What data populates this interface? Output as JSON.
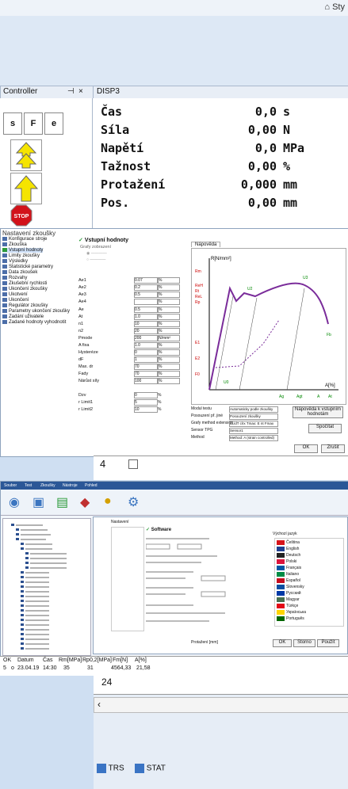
{
  "top": {
    "style_label": "Sty"
  },
  "controller": {
    "title": "Controller",
    "pin_glyph": "⊣",
    "close_glyph": "×",
    "btn_s": "s",
    "btn_f": "F",
    "btn_e": "e",
    "stop_label": "STOP"
  },
  "display": {
    "title": "DISP3",
    "rows": [
      {
        "label": "Čas",
        "value": "0,0",
        "unit": "s"
      },
      {
        "label": "Síla",
        "value": "0,00",
        "unit": "N"
      },
      {
        "label": "Napětí",
        "value": "0,0",
        "unit": "MPa"
      },
      {
        "label": "Tažnost",
        "value": "0,00",
        "unit": "%"
      },
      {
        "label": "Protažení",
        "value": "0,000",
        "unit": "mm"
      },
      {
        "label": "Pos.",
        "value": "0,00",
        "unit": "mm"
      }
    ]
  },
  "dialog1": {
    "title": "Nastavení zkoušky",
    "tree": [
      "Konfigurace stroje",
      "Zkouška",
      "Vstupní hodnoty",
      "Limity zkoušky",
      "Výsledky",
      "Statistické parametry",
      "Data zkoušek",
      "Rozvahy",
      "Zkušební rychlosti",
      "Ukončení zkoušky",
      "Ukotvení",
      "Ukončení",
      "Regulátor zkoušky",
      "Parametry ukončení zkoušky",
      "Zadání uživatele",
      "Zadané hodnoty vyhodnotit"
    ],
    "section_title": "Vstupní hodnoty",
    "subsection": "Grafy zobrazení",
    "graph_tab": "Nápověda",
    "fields": [
      {
        "label": "Ae1",
        "value": "0.07",
        "unit": "%"
      },
      {
        "label": "Ae2",
        "value": "0.2",
        "unit": "%"
      },
      {
        "label": "Ae3",
        "value": "0.5",
        "unit": "%"
      },
      {
        "label": "Ae4",
        "value": "",
        "unit": "%"
      },
      {
        "label": "Ae",
        "value": "0.5",
        "unit": "%"
      },
      {
        "label": "At",
        "value": "1.0",
        "unit": "%"
      },
      {
        "label": "n1",
        "value": "10",
        "unit": "%"
      },
      {
        "label": "n2",
        "value": "20",
        "unit": "%"
      },
      {
        "label": "Pmode",
        "value": "200",
        "unit": "N/mm²"
      },
      {
        "label": "A fixa",
        "value": "1.0",
        "unit": "%"
      },
      {
        "label": "Hysteréze",
        "value": "0",
        "unit": "%"
      },
      {
        "label": "dF",
        "value": "1",
        "unit": "%"
      },
      {
        "label": "Max. dr",
        "value": "70",
        "unit": "%"
      },
      {
        "label": "Fady",
        "value": "70",
        "unit": "%"
      },
      {
        "label": "Nárůst síly",
        "value": "100",
        "unit": "%"
      }
    ],
    "fields2": [
      {
        "label": "Dzv",
        "value": "0",
        "unit": "%"
      },
      {
        "label": "r Limit1",
        "value": "5",
        "unit": "%"
      },
      {
        "label": "r Limit2",
        "value": "10",
        "unit": "%"
      }
    ],
    "graph_labels": {
      "y": "R[N/mm²]",
      "x": "A[%]",
      "pts": [
        "Rm",
        "ReH",
        "Rt",
        "ReL",
        "Rp",
        "U3",
        "U2",
        "Fb",
        "E1",
        "E2",
        "F0",
        "U0",
        "Ag",
        "Agt",
        "A",
        "At"
      ]
    },
    "selects": [
      {
        "label": "Modul testu",
        "value": "Automaticky podle zkoušky"
      },
      {
        "label": "Posouzení př. jiné",
        "value": "Posouzení zkoušky"
      },
      {
        "label": "Grafy method extension",
        "value": "dL/dT clrx Tmax: E nt Fmax"
      },
      {
        "label": "Sensor TPG",
        "value": "Sensor1"
      },
      {
        "label": "Method",
        "value": "Method: A (strain controlled)"
      }
    ],
    "help_btn": "Nápověda k vstupním hodnotám",
    "calc_btn": "Spočítat",
    "ok_btn": "OK",
    "cancel_btn": "Zrušit"
  },
  "grid": {
    "row_number": "4"
  },
  "app2": {
    "menu": [
      "Soubor",
      "Test",
      "Zkoušky",
      "Nástroje",
      "Pohled"
    ],
    "dialog_title": "Nastavení",
    "section": "Software",
    "languages_title": "Výchozí jazyk",
    "languages": [
      "Čeština",
      "English",
      "Deutsch",
      "Polski",
      "Français",
      "Italiano",
      "Español",
      "Slovensky",
      "Русский",
      "Magyar",
      "Türkçe",
      "Українська",
      "Português"
    ],
    "ok": "OK",
    "storno": "Storno",
    "apply": "Použít",
    "chart_xlabel": "Protažení [mm]"
  },
  "status": {
    "headers": [
      "OK",
      "Datum",
      "Čas",
      "Rm[MPa]",
      "Rp0,2[MPa]",
      "Fm[N]",
      "A[%]"
    ],
    "row": [
      "5",
      "o",
      "23.04.19",
      "14:30",
      "35",
      "31",
      "4564,33",
      "21,58"
    ]
  },
  "bottom": {
    "row_number": "24",
    "tabs": [
      "TRS",
      "STAT"
    ]
  }
}
